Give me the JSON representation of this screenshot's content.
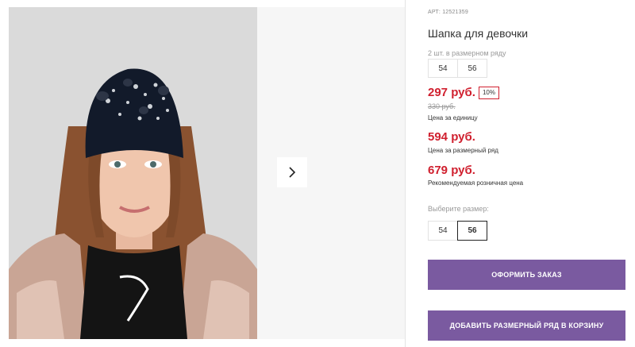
{
  "product": {
    "article": "АРТ: 12521359",
    "title": "Шапка для девочки",
    "sizes_note": "2 шт. в размерном ряду",
    "size_range": [
      "54",
      "56"
    ],
    "price_unit": "297 руб.",
    "discount_badge": "10%",
    "old_price": "330 руб.",
    "price_unit_caption": "Цена за единицу",
    "price_range": "594 руб.",
    "price_range_caption": "Цена за размерный ряд",
    "price_retail": "679 руб.",
    "price_retail_caption": "Рекомендуемая розничная цена",
    "choose_size_label": "Выберите размер:",
    "size_options": [
      "54",
      "56"
    ],
    "selected_size": "56"
  },
  "actions": {
    "order_label": "ОФОРМИТЬ ЗАКАЗ",
    "add_range_label": "ДОБАВИТЬ РАЗМЕРНЫЙ РЯД В КОРЗИНУ"
  },
  "gallery": {
    "next_icon": "chevron-right-icon"
  },
  "colors": {
    "accent": "#7a5aa0",
    "price": "#d0202f"
  }
}
